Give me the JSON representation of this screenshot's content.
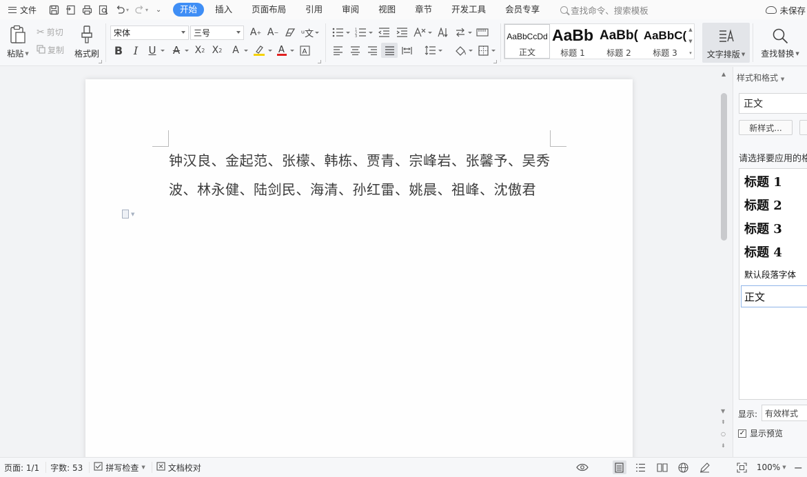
{
  "app": {
    "file_menu": "文件",
    "unsaved": "未保存"
  },
  "tabs": [
    "开始",
    "插入",
    "页面布局",
    "引用",
    "审阅",
    "视图",
    "章节",
    "开发工具",
    "会员专享"
  ],
  "active_tab": "开始",
  "search": {
    "placeholder": "查找命令、搜索模板"
  },
  "clipboard": {
    "paste": "粘贴",
    "cut": "剪切",
    "copy": "复制",
    "format_painter": "格式刷"
  },
  "font": {
    "family": "宋体",
    "size": "三号"
  },
  "styles_gallery": [
    {
      "sample": "AaBbCcDd",
      "name": "正文"
    },
    {
      "sample": "AaBb",
      "name": "标题 1"
    },
    {
      "sample": "AaBb(",
      "name": "标题 2"
    },
    {
      "sample": "AaBbC(",
      "name": "标题 3"
    }
  ],
  "text_layout": {
    "label": "文字排版"
  },
  "find_replace": {
    "label": "查找替换"
  },
  "document": {
    "text": "钟汉良、金起范、张檬、韩栋、贾青、宗峰岩、张馨予、吴秀波、林永健、陆剑民、海清、孙红雷、姚晨、祖峰、沈傲君"
  },
  "task_pane": {
    "title": "样式和格式",
    "current_style": "正文",
    "new_style": "新样式...",
    "hint": "请选择要应用的格式",
    "styles": [
      {
        "label": "标题 1",
        "kind": "heading"
      },
      {
        "label": "标题 2",
        "kind": "heading"
      },
      {
        "label": "标题 3",
        "kind": "heading"
      },
      {
        "label": "标题 4",
        "kind": "heading"
      },
      {
        "label": "默认段落字体",
        "kind": "small"
      },
      {
        "label": "正文",
        "kind": "selected"
      }
    ],
    "show_label": "显示:",
    "show_value": "有效样式",
    "preview_label": "显示预览",
    "preview_checked": true
  },
  "status": {
    "page": "页面: 1/1",
    "word_count": "字数: 53",
    "spell_check": "拼写检查",
    "proofread": "文档校对",
    "zoom": "100%"
  },
  "colors": {
    "accent": "#3f8ef5",
    "highlight_bar": "#f5d100",
    "font_color_bar": "#e02020"
  }
}
